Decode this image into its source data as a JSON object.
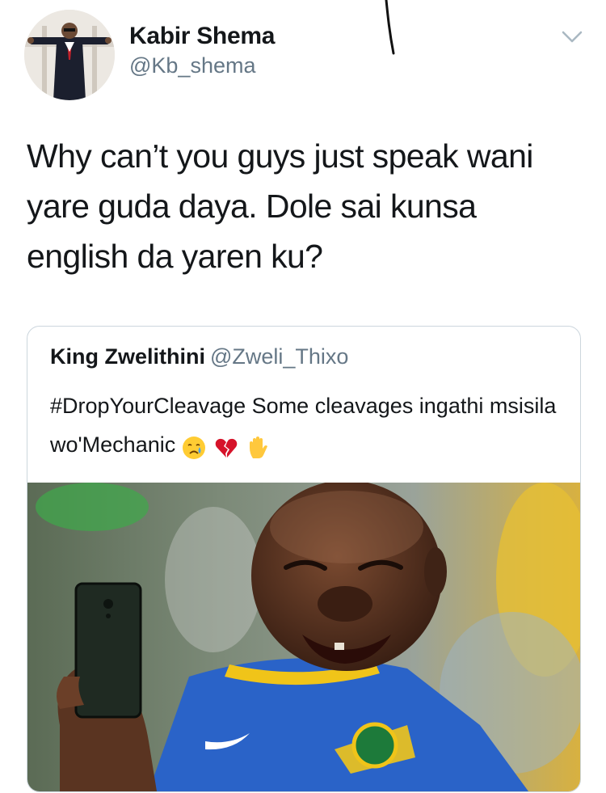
{
  "tweet": {
    "author_name": "Kabir Shema",
    "author_handle": "@Kb_shema",
    "text": "Why can’t you guys just speak wani yare guda daya. Dole sai kunsa english da yaren ku?"
  },
  "quoted_tweet": {
    "author_name": "King Zwelithini",
    "author_handle": "@Zweli_Thixo",
    "text": "#DropYourCleavage Some cleavages ingathi msisila wo'Mechanic",
    "emojis": [
      "crying-face-icon",
      "broken-heart-icon",
      "raised-hand-icon"
    ]
  },
  "icons": {
    "menu": "chevron-down-icon"
  },
  "colors": {
    "text": "#14171a",
    "secondary_text": "#657786",
    "border": "#ccd6dd",
    "shirt_blue": "#2a63c8",
    "shirt_yellow": "#f0c419"
  }
}
